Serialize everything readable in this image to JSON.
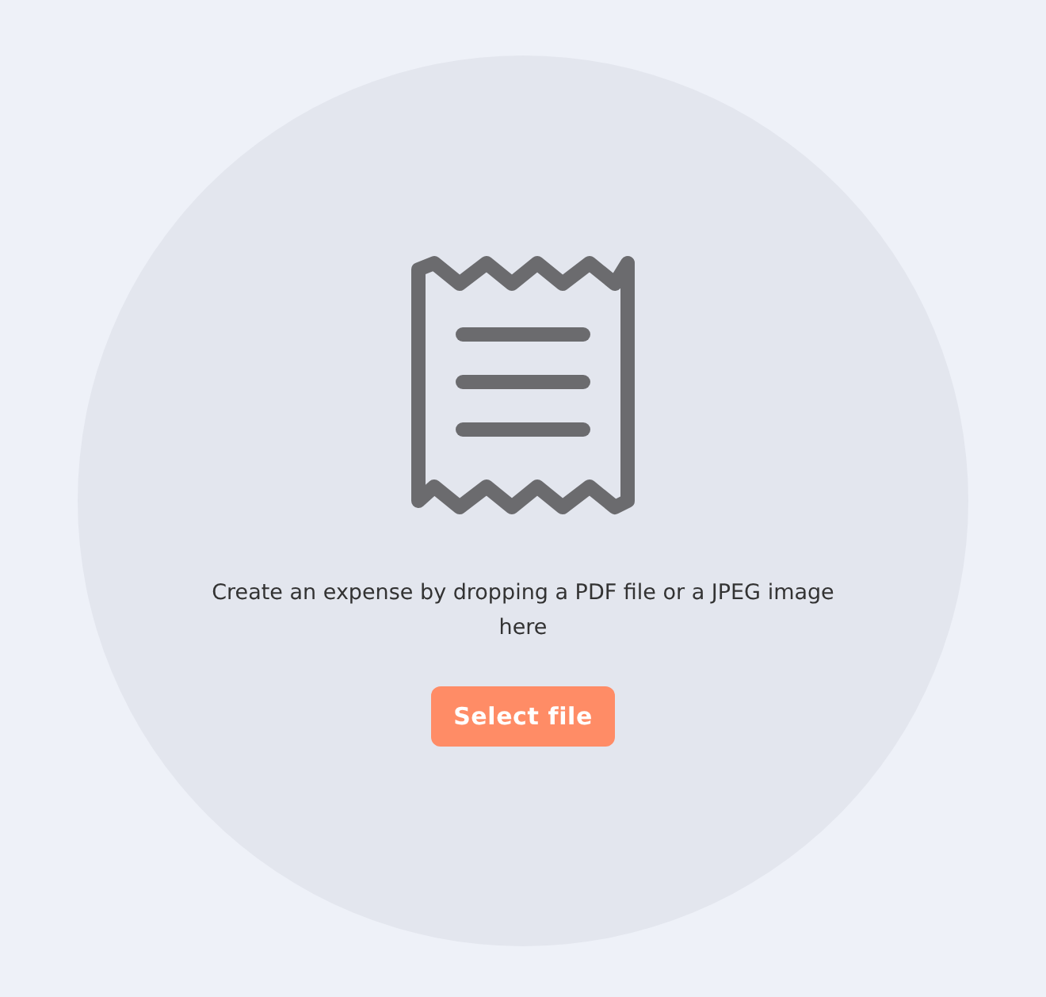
{
  "dropzone": {
    "message": "Create an expense by dropping a PDF file or a JPEG image here",
    "button": "Select file"
  }
}
